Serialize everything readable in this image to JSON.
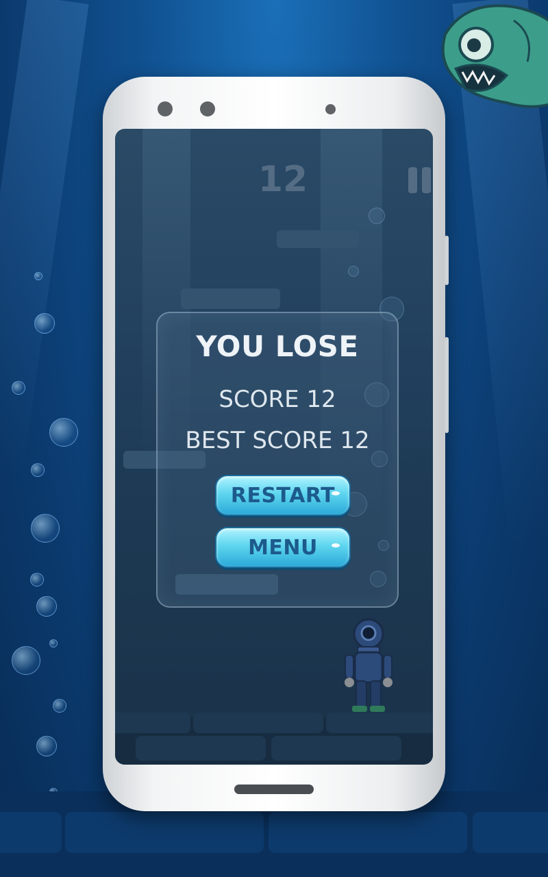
{
  "game": {
    "current_score": "12"
  },
  "dialog": {
    "title": "YOU LOSE",
    "score_line": "SCORE 12",
    "best_score_line": "BEST SCORE 12",
    "restart_label": "RESTART",
    "menu_label": "MENU"
  },
  "colors": {
    "background": "#10508f",
    "button_top": "#aef3ff",
    "button_bottom": "#2aa9d8",
    "button_text": "#1d5a8c",
    "dialog_text": "#eef3f7"
  },
  "icons": [
    "pause-icon",
    "fish-icon",
    "diver-character"
  ]
}
